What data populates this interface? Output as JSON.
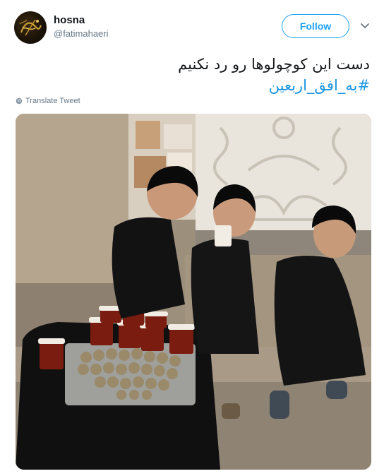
{
  "author": {
    "name": "hosna",
    "handle": "@fatimahaeri",
    "avatar_icon": "calligraphy-avatar-icon"
  },
  "actions": {
    "follow_label": "Follow",
    "more_icon": "chevron-down-icon"
  },
  "tweet": {
    "text": "دست این کوچولوها رو رد نکنیم",
    "hashtag": "#به_افق_اربعین",
    "translate_label": "Translate Tweet"
  },
  "colors": {
    "accent": "#1da1f2",
    "hashtag": "#1b95e0",
    "secondary_text": "#657786"
  }
}
